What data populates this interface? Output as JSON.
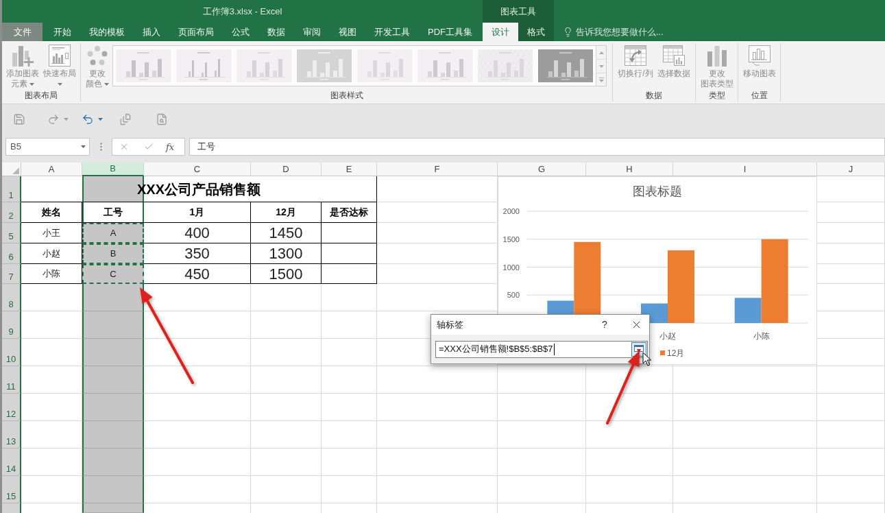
{
  "window": {
    "title": "工作簿3.xlsx - Excel"
  },
  "tabs": [
    {
      "label": "文件",
      "kind": "file",
      "selected": false
    },
    {
      "label": "开始",
      "kind": "tab",
      "selected": false
    },
    {
      "label": "我的模板",
      "kind": "tab",
      "selected": false
    },
    {
      "label": "插入",
      "kind": "tab",
      "selected": false
    },
    {
      "label": "页面布局",
      "kind": "tab",
      "selected": false
    },
    {
      "label": "公式",
      "kind": "tab",
      "selected": false
    },
    {
      "label": "数据",
      "kind": "tab",
      "selected": false
    },
    {
      "label": "审阅",
      "kind": "tab",
      "selected": false
    },
    {
      "label": "视图",
      "kind": "tab",
      "selected": false
    },
    {
      "label": "开发工具",
      "kind": "tab",
      "selected": false
    },
    {
      "label": "PDF工具集",
      "kind": "tab",
      "selected": false
    }
  ],
  "contextual_tabs": {
    "title": "图表工具",
    "tabs": [
      {
        "label": "设计",
        "kind": "tab",
        "selected": true
      },
      {
        "label": "格式",
        "kind": "tab",
        "selected": false
      }
    ]
  },
  "tell_me": {
    "placeholder": "告诉我您想要做什么..."
  },
  "ribbon": {
    "groups": [
      {
        "label": "图表布局",
        "buttons": [
          {
            "lines": [
              "添加图表",
              "元素"
            ],
            "dropdown": true,
            "disabled": true
          },
          {
            "lines": [
              "快速布局"
            ],
            "dropdown": true,
            "disabled": true
          }
        ]
      },
      {
        "label": "图表样式",
        "buttons": [
          {
            "lines": [
              "更改",
              "颜色"
            ],
            "dropdown": true,
            "disabled": true
          }
        ],
        "gallery": {
          "disabled": true
        }
      },
      {
        "label": "数据",
        "buttons": [
          {
            "lines": [
              "切换行/列"
            ],
            "disabled": true
          },
          {
            "lines": [
              "选择数据"
            ],
            "disabled": true
          }
        ]
      },
      {
        "label": "类型",
        "buttons": [
          {
            "lines": [
              "更改",
              "图表类型"
            ],
            "disabled": true
          }
        ]
      },
      {
        "label": "位置",
        "buttons": [
          {
            "lines": [
              "移动图表"
            ],
            "disabled": true
          }
        ]
      }
    ]
  },
  "quick_access": [
    {
      "disabled": true
    },
    {
      "disabled": true,
      "dropdown": true
    },
    {
      "disabled": false,
      "dropdown": true
    },
    {
      "disabled": true
    },
    {
      "disabled": true
    }
  ],
  "formula_bar": {
    "name_box": {
      "value": "B5"
    },
    "insert_function": "fx",
    "formula": {
      "value": "工号"
    }
  },
  "sheet": {
    "columns": [
      {
        "label": "A",
        "selected": false
      },
      {
        "label": "B",
        "selected": true
      },
      {
        "label": "C",
        "selected": false
      },
      {
        "label": "D",
        "selected": false
      },
      {
        "label": "E",
        "selected": false
      },
      {
        "label": "F",
        "selected": false
      },
      {
        "label": "G",
        "selected": false
      },
      {
        "label": "H",
        "selected": false
      },
      {
        "label": "I",
        "selected": false
      },
      {
        "label": "J",
        "selected": false
      }
    ],
    "rows": [
      {
        "label": "1",
        "highlighted": true,
        "cells": [
          {
            "kind": "title",
            "text": "XXX公司产品销售额",
            "active": false,
            "referenced": false
          }
        ]
      },
      {
        "label": "2",
        "highlighted": true,
        "cells": [
          {
            "kind": "header",
            "text": "姓名",
            "active": false,
            "referenced": false
          },
          {
            "kind": "header",
            "text": "工号",
            "active": true,
            "referenced": false
          },
          {
            "kind": "header",
            "text": "1月",
            "active": false,
            "referenced": false
          },
          {
            "kind": "header",
            "text": "12月",
            "active": false,
            "referenced": false
          },
          {
            "kind": "header",
            "text": "是否达标",
            "active": false,
            "referenced": false
          }
        ]
      },
      {
        "label": "5",
        "highlighted": true,
        "cells": [
          {
            "kind": "text",
            "text": "小王",
            "active": false,
            "referenced": false
          },
          {
            "kind": "text",
            "text": "A",
            "active": false,
            "referenced": true
          },
          {
            "kind": "number",
            "text": "400",
            "active": false,
            "referenced": false
          },
          {
            "kind": "number",
            "text": "1450",
            "active": false,
            "referenced": false
          }
        ]
      },
      {
        "label": "6",
        "highlighted": true,
        "cells": [
          {
            "kind": "text",
            "text": "小赵",
            "active": false,
            "referenced": false
          },
          {
            "kind": "text",
            "text": "B",
            "active": false,
            "referenced": true
          },
          {
            "kind": "number",
            "text": "350",
            "active": false,
            "referenced": false
          },
          {
            "kind": "number",
            "text": "1300",
            "active": false,
            "referenced": false
          }
        ]
      },
      {
        "label": "7",
        "highlighted": true,
        "cells": [
          {
            "kind": "text",
            "text": "小陈",
            "active": false,
            "referenced": false
          },
          {
            "kind": "text",
            "text": "C",
            "active": false,
            "referenced": true
          },
          {
            "kind": "number",
            "text": "450",
            "active": false,
            "referenced": false
          },
          {
            "kind": "number",
            "text": "1500",
            "active": false,
            "referenced": false
          }
        ]
      },
      {
        "label": "8",
        "highlighted": true
      },
      {
        "label": "9",
        "highlighted": true
      },
      {
        "label": "10",
        "highlighted": true
      },
      {
        "label": "11",
        "highlighted": true
      },
      {
        "label": "12",
        "highlighted": true
      },
      {
        "label": "13",
        "highlighted": true
      },
      {
        "label": "14",
        "highlighted": true
      },
      {
        "label": "15",
        "highlighted": true
      }
    ]
  },
  "chart": {
    "chart_data": {
      "type": "bar",
      "title": "图表标题",
      "categories": [
        null,
        "小赵",
        "小陈"
      ],
      "series": [
        {
          "color": "#5b9bd5",
          "values": [
            400,
            350,
            450
          ]
        },
        {
          "name": "12月",
          "color": "#ed7d31",
          "values": [
            1450,
            1300,
            1500
          ]
        }
      ],
      "ylim": [
        0,
        2000
      ],
      "yticks": [
        500,
        1000,
        1500,
        2000
      ],
      "grid": true
    }
  },
  "dialog": {
    "title": "轴标签",
    "help": "?",
    "field": {
      "value": "=XXX公司销售额!$B$5:$B$7"
    }
  }
}
